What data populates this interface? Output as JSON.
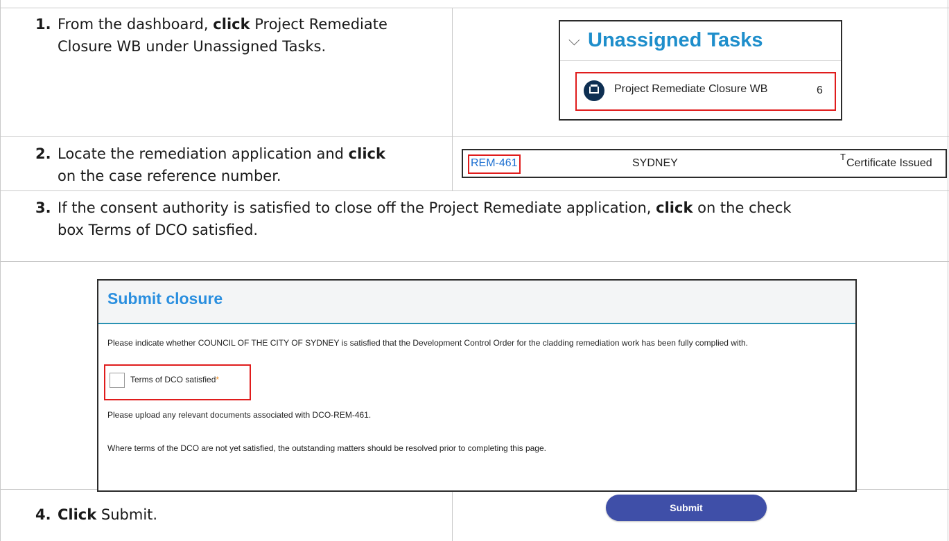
{
  "steps": [
    {
      "num": "1.",
      "line1_pre": "From the dashboard, ",
      "keyword": "click",
      "line1_post": " Project Remediate",
      "line2": "Closure WB under Unassigned Tasks."
    },
    {
      "num": "2.",
      "line1_pre": "Locate the remediation application and ",
      "keyword": "click",
      "line2": "on the case reference number."
    },
    {
      "num": "3.",
      "line1_pre": "If the consent authority is satisfied to close off the Project Remediate application, ",
      "keyword": "click",
      "line1_post": " on the check",
      "line2": "box Terms of DCO satisfied."
    },
    {
      "num": "4.",
      "keyword": "Click",
      "line1_post": " Submit."
    }
  ],
  "unassigned_tasks": {
    "chevron": "chevron-down-icon",
    "title": "Unassigned Tasks",
    "item_icon": "inbox-tray-icon",
    "item_label": "Project Remediate Closure WB",
    "item_count": "6"
  },
  "case_row": {
    "reference": "REM-461",
    "city": "SYDNEY",
    "type": "T",
    "status": "Certificate Issued"
  },
  "submit_closure": {
    "title": "Submit closure",
    "intro": "Please indicate whether COUNCIL OF THE CITY OF SYDNEY is satisfied that the Development Control Order for the cladding remediation work has been fully complied with.",
    "checkbox_label": "Terms of DCO satisfied",
    "required_mark": "*",
    "upload_text": "Please upload any relevant documents associated with DCO-REM-461.",
    "note": "Where terms of the DCO are not yet satisfied, the outstanding matters should be resolved prior to completing this page."
  },
  "submit_button": {
    "label": "Submit"
  },
  "colors": {
    "highlight": "#e01c1c",
    "title_blue": "#1e8ecb",
    "link_blue": "#1c6fd1",
    "button": "#3f4fa8",
    "required": "#f08c1e"
  }
}
